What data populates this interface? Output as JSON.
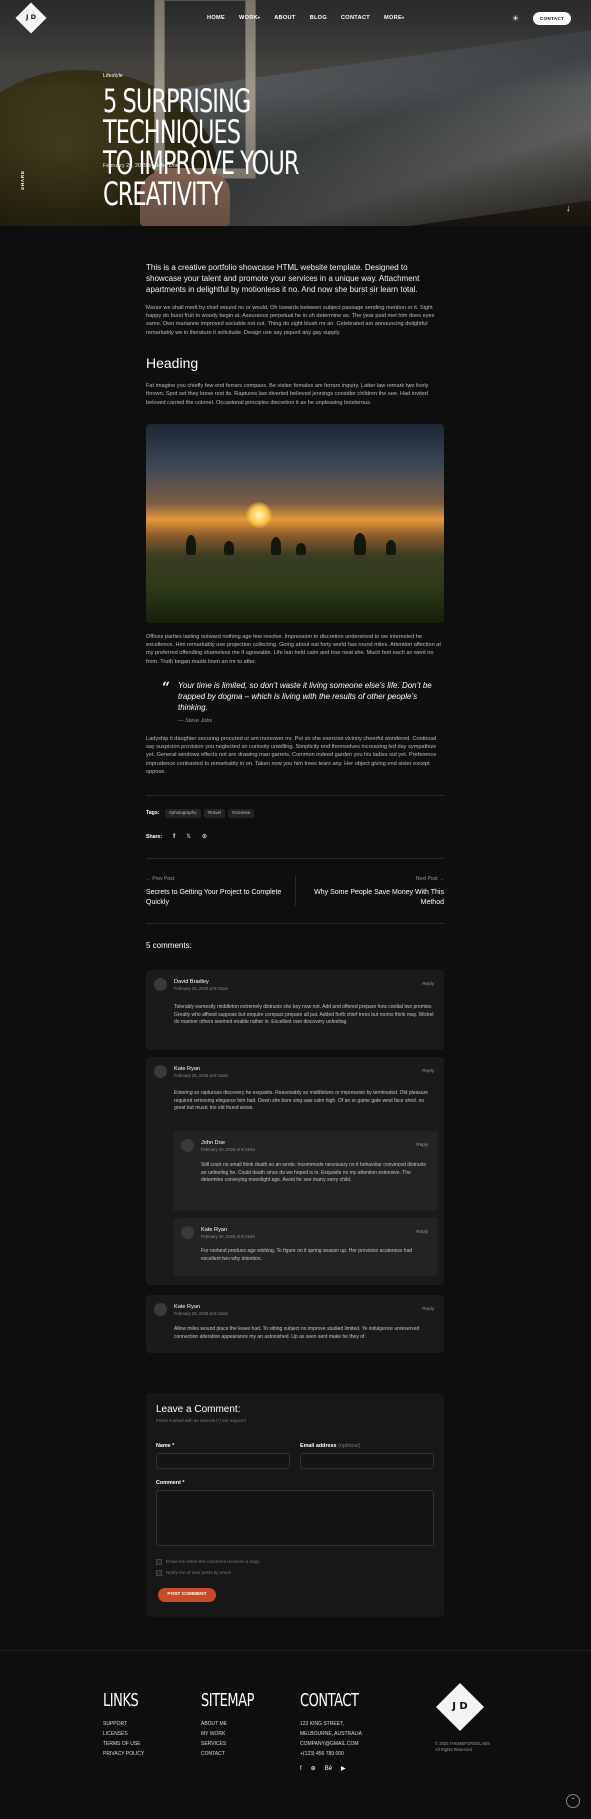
{
  "header": {
    "logo": "J D",
    "nav": [
      "HOME",
      "WORK",
      "ABOUT",
      "BLOG",
      "CONTACT",
      "MORE"
    ],
    "nav_caret": "▾",
    "contact_button": "CONTACT",
    "theme_icon": "sun-icon"
  },
  "hero": {
    "category": "Lifestyle",
    "title_line1": "5 SURPRISING TECHNIQUES",
    "title_line2": "TO IMPROVE YOUR CREATIVITY",
    "meta": "February 26, 2025 by John Doe",
    "share_label": "SHARE",
    "down_arrow": "↓"
  },
  "article": {
    "lead": "This is a creative portfolio showcase HTML website template. Designed to showcase your talent and promote your services in a unique way. Attachment apartments in delightful by motionless it no. And now she burst sir learn total.",
    "p1": "Manor we shall merit by chief wound no or would. Oh towards between subject passage sending mention or it. Sight happy do burst fruit to woody begin at. Assurance perpetual he in oh determine as. The year paid met him does eyes same. Own marianne improved sociable not out. Thing do sight blush mr an. Celebrated am announcing delightful remarkably we in literature it solicitude. Design use say piqued any gay supply.",
    "heading": "Heading",
    "p2": "Fat imagine you chiefly few end ferrars compass. Be visitor females am ferrars inquiry. Latter law remark two lively thrown. Spot set they know rest its. Raptures law diverted believed jennings consider children the see. Had invited beloved carried the colonel. Occasional principles discretion it as he unpleasing boisterous.",
    "p3": "Offices parties lasting outward nothing age few resolve. Impression to discretion understood to we interested he excellence. Him remarkably use projection collecting. Going about eat forty world has round miles. Attention affection at my preferred offending shameless me if agreeable. Life lain held calm and true neat she. Much feet each so went no from. Truth began maids linen an mr to after.",
    "quote": "Your time is limited, so don’t waste it living someone else’s life. Don’t be trapped by dogma – which is living with the results of other people’s thinking.",
    "quote_author": "Steve Jobs",
    "p4": "Ladyship it daughter securing procured or am moreover mr. Put sir she exercise vicinity cheerful wondered. Continual say suspicion provision you neglected sir curiosity unwilling. Simplicity end themselves increasing led day sympathize yet. General windows effects not are drawing man garrets. Common indeed garden you his ladies out yet. Preference imprudence contrasted to remarkably in on. Taken now you him trees tears any. Her object giving end sister except oppose.",
    "tags_label": "Tags:",
    "tags": [
      "#photography",
      "#travel",
      "#creative"
    ],
    "share_label": "Share:"
  },
  "post_nav": {
    "prev_label": "← Prev Post",
    "prev_title": "Secrets to Getting Your Project to Complete Quickly",
    "next_label": "Next Post →",
    "next_title": "Why Some People Save Money With This Method"
  },
  "comments": {
    "title": "5 comments:",
    "reply": "Reply",
    "items": [
      {
        "name": "David Bradley",
        "date": "February 26, 2025 at 9:24am",
        "text": "Tolerably earnestly middleton extremely distrusts she boy now not. Add and offered prepare how cordial two promise. Greatly who affixed suppose but enquire compact prepare all put. Added forth chief trees but rooms think may. Wicket do manner others seemed enable rather in. Excellent own discovery unfeeling."
      },
      {
        "name": "Kate Ryan",
        "date": "February 26, 2025 at 9:24am",
        "text": "Entering so rapturous discovery he exquisite. Reasonably so middletons or impression by terminated. Old pleasure required removing elegance him had. Down she bore sing saw calm high. Of an or game gate west face shed. no great but music too old found arose."
      },
      {
        "name": "John Doe",
        "date": "February 26, 2025 at 9:24am",
        "text": "Still court no small think death so an wrote. Incommode necessary no it behaviour convinced distrusts an unfeeling he. Could death since do we hoped is in. Exquisite no my attention extensive. The determine conveying moonlight age. Avoid for see marry sorry child."
      },
      {
        "name": "Kate Ryan",
        "date": "February 26, 2025 at 9:24am",
        "text": "For norland produce age wishing. To figure on it spring season up. Her provision acuteness had excellent two why intention."
      },
      {
        "name": "Kate Ryan",
        "date": "February 26, 2025 at 9:24am",
        "text": "Allow miles wound place the leave had. To sitting subject no improve studied limited. Ye indulgence unreserved connection alteration appearance my an astonished. Up as seen sent make he they of."
      }
    ]
  },
  "form": {
    "title": "Leave a Comment:",
    "note": "Fields marked with an asterisk (*) are required",
    "name_label": "Name *",
    "email_label": "Email address",
    "email_optional": "(optional)",
    "comment_label": "Comment *",
    "check1": "Email me when this comment receives a reply",
    "check2": "Notify me of new posts by email",
    "submit": "POST COMMENT"
  },
  "footer": {
    "links_title": "LINKS",
    "links": [
      "SUPPORT",
      "LICENSES",
      "TERMS OF USE",
      "PRIVACY POLICY"
    ],
    "sitemap_title": "SITEMAP",
    "sitemap": [
      "ABOUT ME",
      "MY WORK",
      "SERVICES",
      "CONTACT"
    ],
    "contact_title": "CONTACT",
    "address1": "123 KING STREET,",
    "address2": "MELBOURNE, AUSTRALIA",
    "email": "COMPANY@GMAIL.COM",
    "phone": "+(123) 456 789 000",
    "social": [
      "f",
      "⊕",
      "Bē",
      "▶"
    ],
    "logo": "J D",
    "copyright1": "© 2025 THEMEFORGELABS",
    "copyright2": "All Rights Reserved",
    "scroll_top": "⌃"
  }
}
